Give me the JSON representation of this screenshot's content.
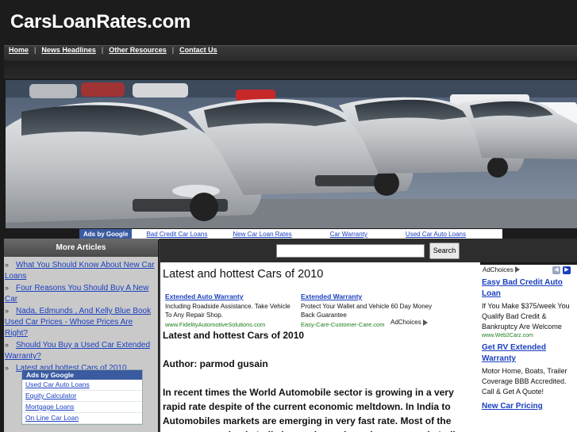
{
  "header": {
    "site_title": "CarsLoanRates.com"
  },
  "nav": {
    "items": [
      {
        "label": "Home"
      },
      {
        "label": "News Headlines"
      },
      {
        "label": "Other Resources"
      },
      {
        "label": "Contact Us"
      }
    ],
    "separator": "|"
  },
  "top_ads": {
    "ads_by": "Ads by Google",
    "links": [
      "Bad Credit Car Loans",
      "New Car Loan Rates",
      "Car Warranty",
      "Used Car Auto Loans"
    ]
  },
  "sidebar": {
    "title": "More Articles",
    "bullet": "»",
    "articles": [
      "What You Should Know About New Car Loans",
      "Four Reasons You Should Buy A New Car",
      "Nada, Edmunds , And Kelly Blue Book Used Car Prices - Whose Prices Are Right?",
      "Should You Buy a Used Car Extended Warranty?",
      "Latest and hottest Cars of 2010"
    ],
    "ads_by": "Ads by Google",
    "ads": [
      "Used Car Auto Loans",
      "Equity Calculator",
      "Mortgage Loans",
      "On Line Car Loan"
    ]
  },
  "search": {
    "button_label": "Search",
    "placeholder": ""
  },
  "main": {
    "page_title": "Latest and hottest Cars of 2010",
    "inline_ads": [
      {
        "title": "Extended Auto Warranty",
        "desc": "Including Roadside Assistance. Take Vehicle To Any Repair Shop.",
        "url": "www.FidelityAutomotiveSolutions.com"
      },
      {
        "title": "Extended Warranty",
        "desc": "Protect Your Wallet and Vehicle 60 Day Money Back Guarantee",
        "url": "Easy-Care-Customer-Care.com"
      }
    ],
    "adchoices": "AdChoices",
    "article_heading": "Latest and hottest Cars of 2010",
    "author": "Author: parmod gusain",
    "paragraph": "In recent times the World Automobile sector is growing in a very rapid rate despite of the current economic meltdown. In India to Automobiles markets are emerging in very fast rate. Most of the young generation in India is very keen about the new cars in Indian"
  },
  "right_ads": {
    "adchoices": "AdChoices",
    "prev_glyph": "◀",
    "next_glyph": "▶",
    "items": [
      {
        "title": "Easy Bad Credit Auto Loan",
        "desc": "If You Make $375/week You Qualify Bad Credit & Bankruptcy Are Welcome",
        "url": "www.Web2Carz.com"
      },
      {
        "title": "Get RV Extended Warranty",
        "desc": "Motor Home, Boats, Trailer Coverage BBB Accredited. Call & Get A Quote!",
        "url": ""
      },
      {
        "title": "New Car Pricing",
        "desc": "",
        "url": ""
      }
    ]
  },
  "colors": {
    "link": "#1a3fbf",
    "ads_header": "#3a5ba0",
    "ad_url": "#1b7d1b",
    "header_bg": "#1c1c1c"
  }
}
